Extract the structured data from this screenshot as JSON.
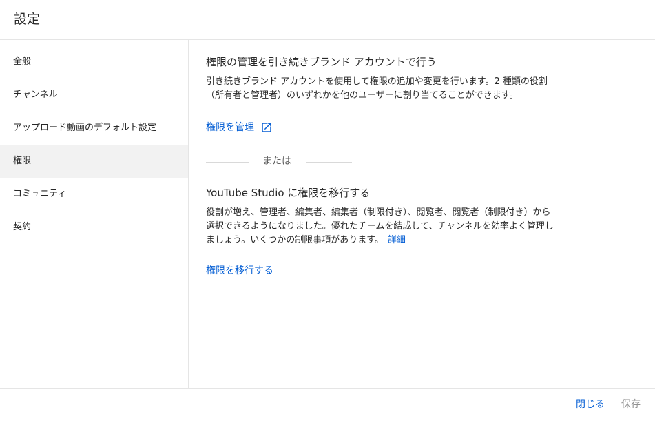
{
  "header": {
    "title": "設定"
  },
  "sidebar": {
    "items": [
      {
        "label": "全般"
      },
      {
        "label": "チャンネル"
      },
      {
        "label": "アップロード動画のデフォルト設定"
      },
      {
        "label": "権限"
      },
      {
        "label": "コミュニティ"
      },
      {
        "label": "契約"
      }
    ],
    "active_index": 3
  },
  "main": {
    "brand_section": {
      "title": "権限の管理を引き続きブランド アカウントで行う",
      "desc_line1": "引き続きブランド アカウントを使用して権限の追加や変更を行います。2 種類の役割",
      "desc_line2": "（所有者と管理者）のいずれかを他のユーザーに割り当てることができます。",
      "manage_link": "権限を管理",
      "manage_icon": "open-in-new-icon"
    },
    "divider_text": "または",
    "studio_section": {
      "title": "YouTube Studio に権限を移行する",
      "desc_line1": "役割が増え、管理者、編集者、編集者（制限付き）、閲覧者、閲覧者（制限付き）から",
      "desc_line2": "選択できるようになりました。優れたチームを結成して、チャンネルを効率よく管理し",
      "desc_line3": "ましょう。いくつかの制限事項があります。",
      "details_link": "詳細",
      "migrate_link": "権限を移行する"
    }
  },
  "footer": {
    "close_label": "閉じる",
    "save_label": "保存"
  },
  "colors": {
    "link": "#065fd4",
    "text": "#282828",
    "secondary_text": "#606060",
    "disabled_text": "#909090",
    "active_bg": "#f2f2f2",
    "border": "#e5e5e5"
  }
}
